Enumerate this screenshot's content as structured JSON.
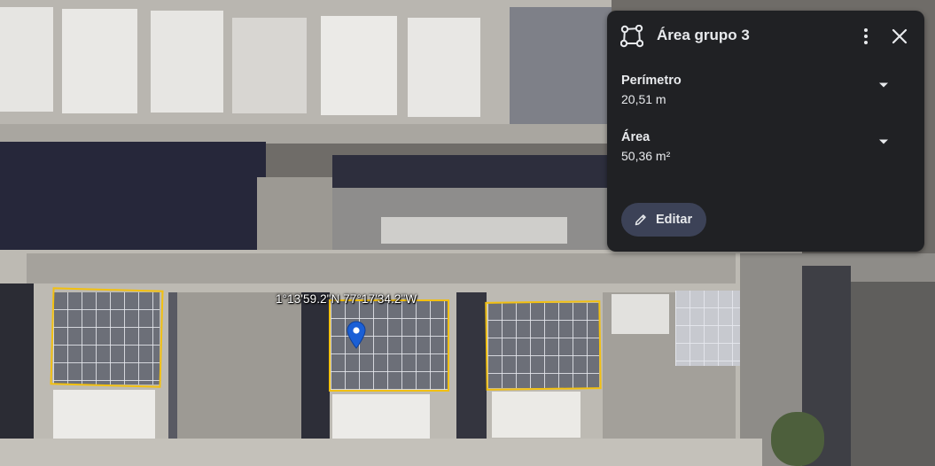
{
  "map": {
    "coordinates_label": "1°13'59.2\"N 77°17'34.2\"W",
    "outline_color": "#f2c011",
    "pin_color": "#1a5fd6"
  },
  "card": {
    "title": "Área grupo 3",
    "icons": {
      "type": "polygon-icon",
      "menu": "more-vert-icon",
      "close": "close-icon",
      "expand": "chevron-down-icon",
      "edit": "pencil-icon"
    },
    "metrics": [
      {
        "label": "Perímetro",
        "value": "20,51 m"
      },
      {
        "label": "Área",
        "value": "50,36 m²"
      }
    ],
    "edit_label": "Editar",
    "colors": {
      "background": "#202124",
      "button": "#3c4257",
      "text": "#e8eaed"
    }
  }
}
